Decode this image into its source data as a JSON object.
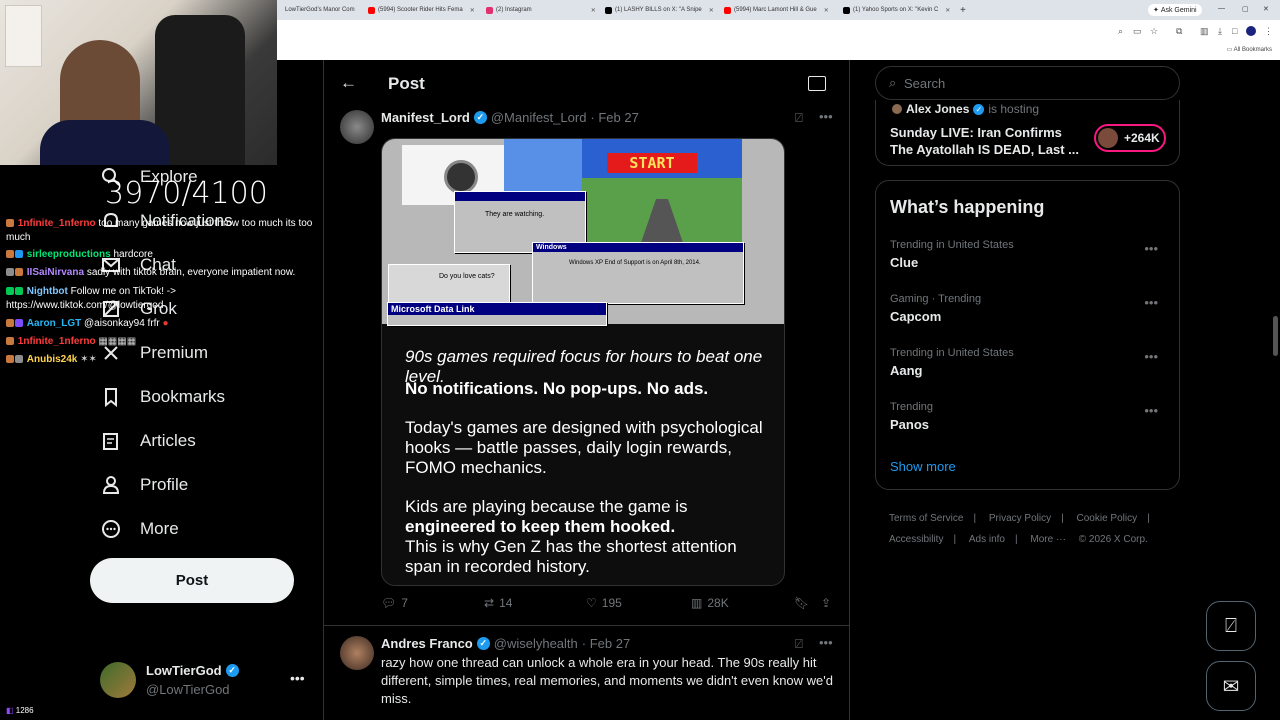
{
  "browser": {
    "tabs": [
      {
        "label": "LowTierGod's Manor Com",
        "color": "#ffcc00"
      },
      {
        "label": "(5994) Scooter Rider Hits Fema",
        "color": "#ff0000"
      },
      {
        "label": "(2) Instagram",
        "color": "#e1306c"
      },
      {
        "label": "(1) LASHY BILLS on X: \"A Snipe",
        "color": "#000000"
      },
      {
        "label": "(5994) Marc Lamont Hill & Gue",
        "color": "#ff0000"
      },
      {
        "label": "(1) Yahoo Sports on X: \"Kevin C",
        "color": "#000000"
      }
    ],
    "ask_gemini": "Ask Gemini",
    "all_bookmarks": "All Bookmarks"
  },
  "stream": {
    "goal": "3970/4100",
    "viewers": "1286",
    "chat": [
      {
        "user": "1nfinite_1nferno",
        "color": "#ff3b3b",
        "text": "too many games now just throw too much its too"
      },
      {
        "user": "",
        "color": "#ffffff",
        "text": "much"
      },
      {
        "user": "sirleeproductions",
        "color": "#00e676",
        "text": "hardcore"
      },
      {
        "user": "IISaiNirvana",
        "color": "#b388ff",
        "text": "sadly with tiktok brain, everyone impatient now."
      },
      {
        "user": "Nightbot",
        "color": "#7ec8ff",
        "text": "Follow me on TikTok! ->"
      },
      {
        "user": "",
        "color": "#ffffff",
        "text": "https://www.tiktok.com/@lowtiergod"
      },
      {
        "user": "Aaron_LGT",
        "color": "#29b6f6",
        "text": "@aisonkay94 frfr"
      },
      {
        "user": "1nfinite_1nferno",
        "color": "#ff3b3b",
        "text": ""
      },
      {
        "user": "Anubis24k",
        "color": "#ffd54f",
        "text": ""
      }
    ]
  },
  "nav": {
    "items": [
      {
        "label": "Explore",
        "icon": "search-icon"
      },
      {
        "label": "Notifications",
        "icon": "bell-icon"
      },
      {
        "label": "Chat",
        "icon": "mail-icon"
      },
      {
        "label": "Grok",
        "icon": "grok-icon"
      },
      {
        "label": "Premium",
        "icon": "x-premium-icon"
      },
      {
        "label": "Bookmarks",
        "icon": "bookmark-icon"
      },
      {
        "label": "Articles",
        "icon": "article-icon"
      },
      {
        "label": "Profile",
        "icon": "person-icon"
      },
      {
        "label": "More",
        "icon": "more-circle-icon"
      }
    ],
    "post_button": "Post",
    "user": {
      "name": "LowTierGod",
      "handle": "@LowTierGod"
    }
  },
  "main": {
    "header_title": "Post",
    "tweet": {
      "name": "Manifest_Lord",
      "handle": "@Manifest_Lord",
      "date": "· Feb 27",
      "image_text": {
        "line1": "90s games required focus for hours to beat one level.",
        "line2": "No notifications. No pop-ups. No ads.",
        "line3": "Today's games are designed with psychological hooks — battle passes, daily login rewards, FOMO mechanics.",
        "line4": "Kids are playing because the game is",
        "line5": "engineered to keep them hooked.",
        "line6": "This is why Gen Z has the shortest attention span in recorded history.",
        "start": "START",
        "popup_watching": "They are watching.",
        "popup_windows": "Windows XP End of Support is on April 8th, 2014.",
        "popup_data_link": "Microsoft Data Link",
        "popup_love": "Do you love cats?"
      },
      "replies": "7",
      "reposts": "14",
      "likes": "195",
      "views": "28K"
    },
    "reply": {
      "name": "Andres Franco",
      "handle": "@wiselyhealth",
      "date": "· Feb 27",
      "text": "razy how one thread can unlock a whole era in your head. The 90s really hit different, simple times, real memories, and moments we didn't even know we'd miss."
    }
  },
  "right": {
    "search_placeholder": "Search",
    "live": {
      "host": "Alex Jones",
      "hosting": "is hosting",
      "title": "Sunday LIVE: Iran Confirms The Ayatollah IS DEAD, Last ...",
      "count": "+264K"
    },
    "happening_title": "What’s happening",
    "trends": [
      {
        "context": "Trending in United States",
        "name": "Clue"
      },
      {
        "context": "Gaming · Trending",
        "name": "Capcom"
      },
      {
        "context": "Trending in United States",
        "name": "Aang"
      },
      {
        "context": "Trending",
        "name": "Panos"
      }
    ],
    "show_more": "Show more",
    "footer": [
      "Terms of Service",
      "Privacy Policy",
      "Cookie Policy",
      "Accessibility",
      "Ads info",
      "More ···",
      "© 2026 X Corp."
    ]
  }
}
